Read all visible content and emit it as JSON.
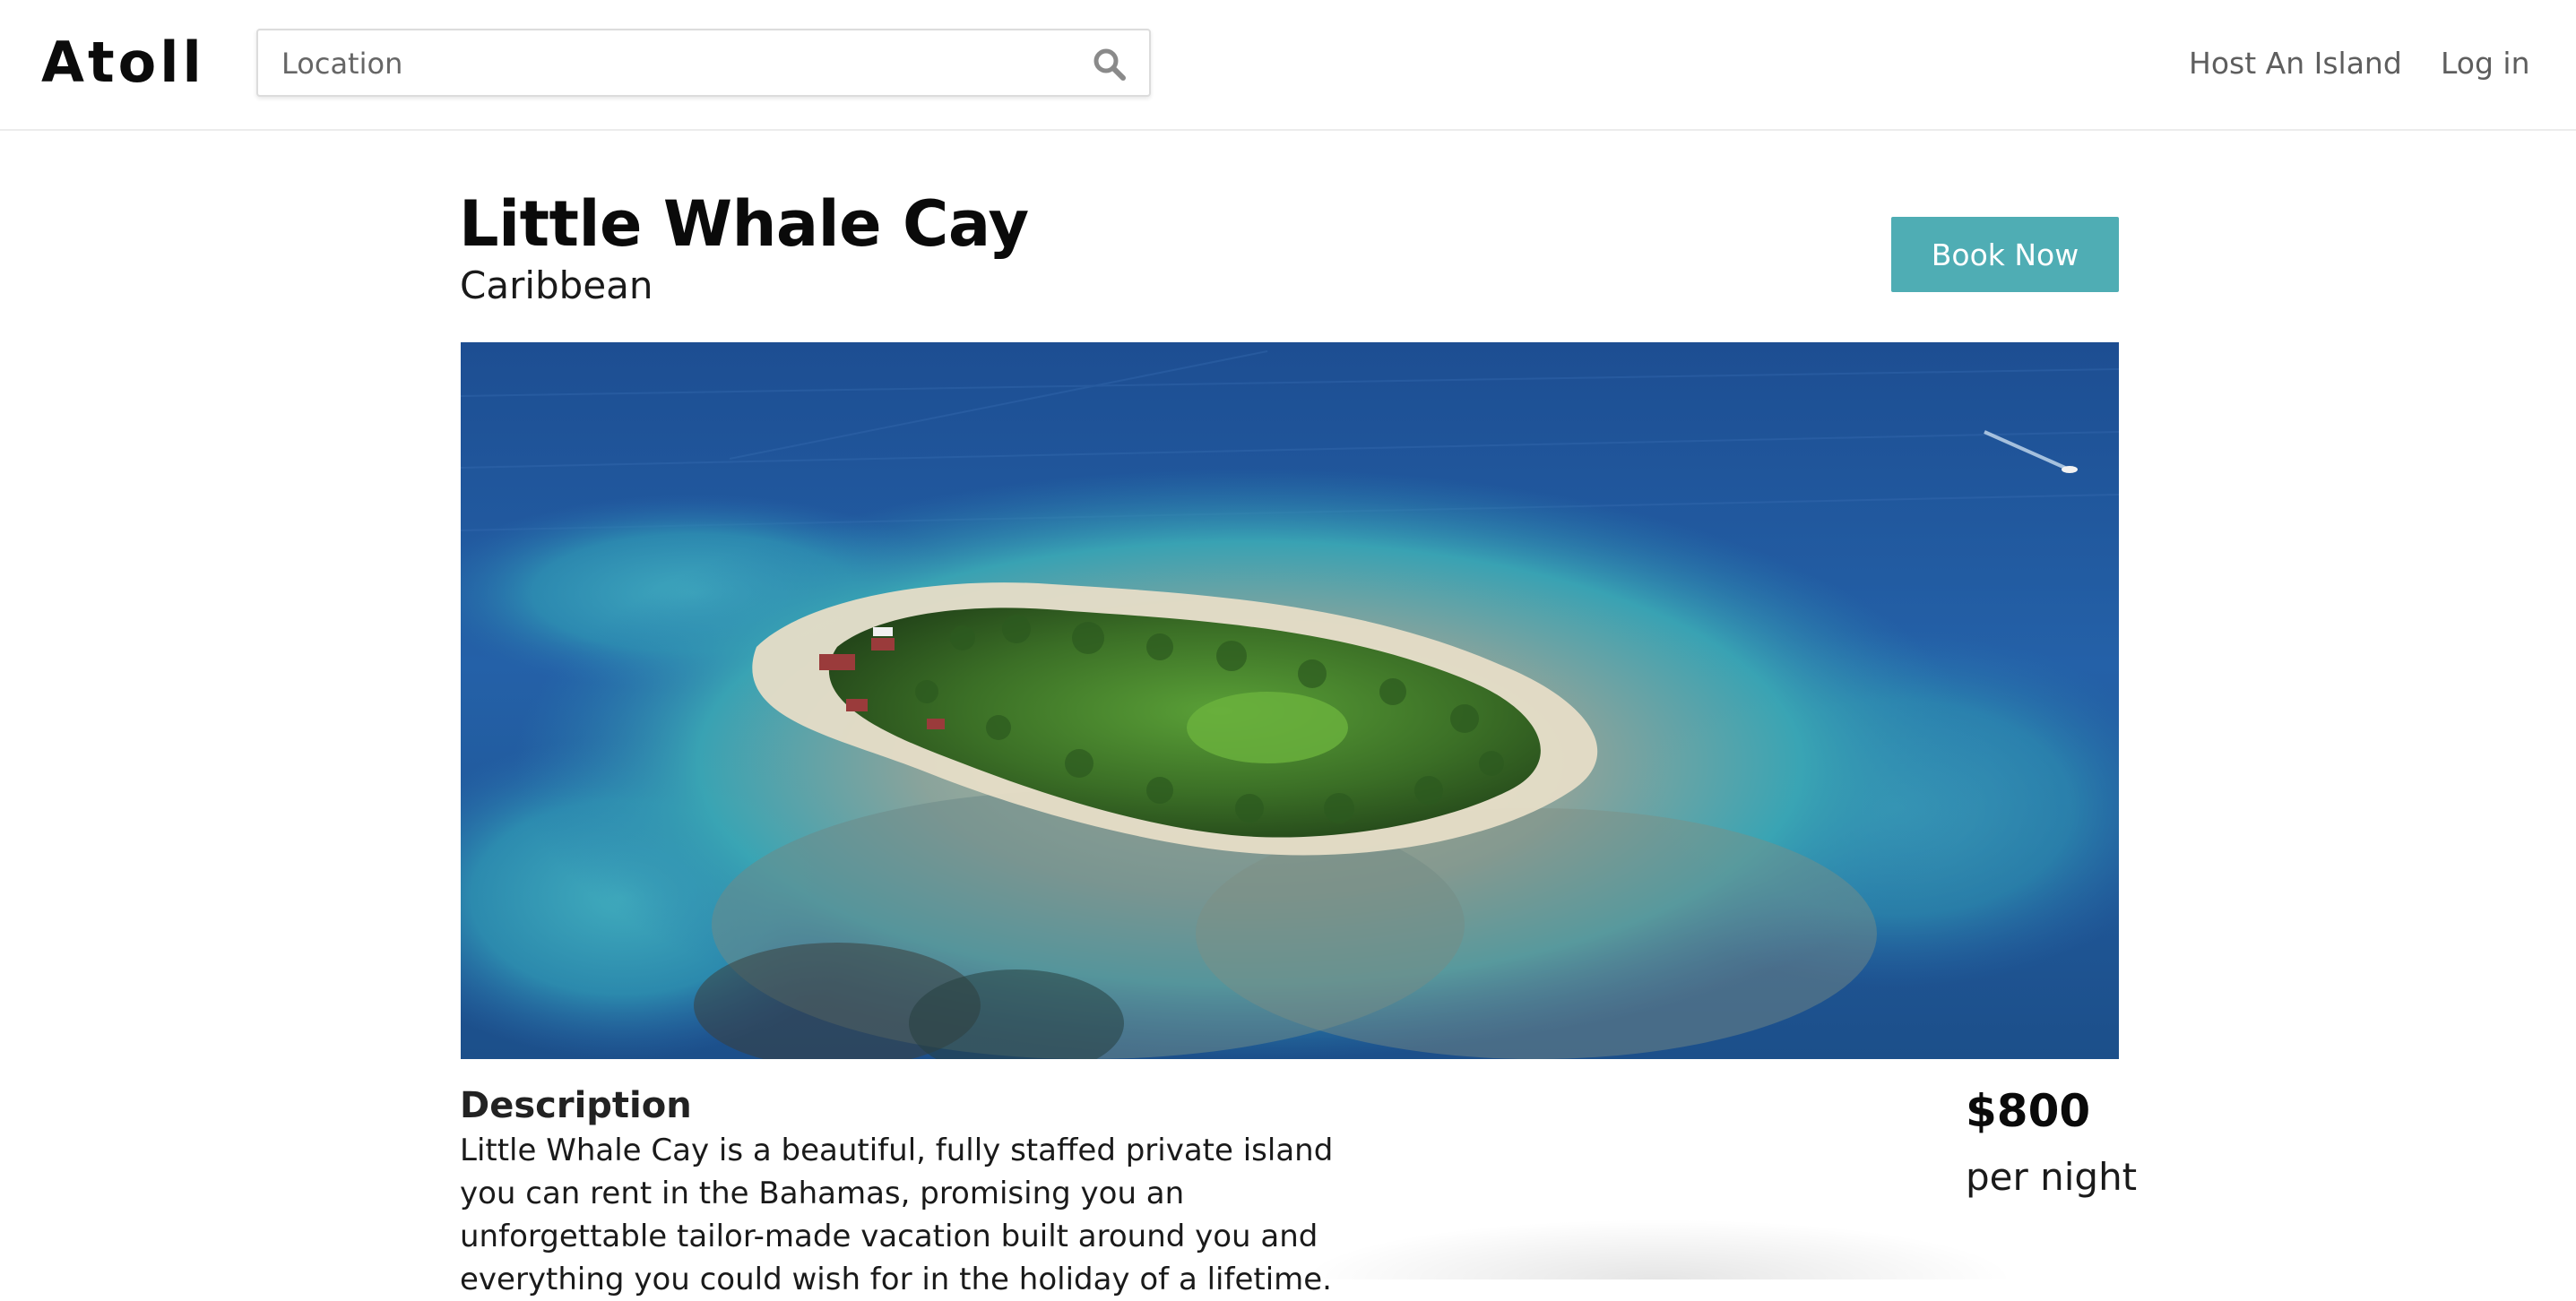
{
  "header": {
    "logo": "Atoll",
    "search": {
      "placeholder": "Location",
      "value": ""
    },
    "nav": {
      "host_label": "Host An Island",
      "login_label": "Log in"
    }
  },
  "listing": {
    "title": "Little Whale Cay",
    "region": "Caribbean",
    "book_label": "Book Now",
    "description_heading": "Description",
    "description": "Little Whale Cay is a beautiful, fully staffed private island you can rent in the Bahamas, promising you an unforgettable tailor-made vacation built around you and everything you could wish for in the holiday of a lifetime.",
    "price": "$800",
    "price_unit": "per night"
  },
  "colors": {
    "accent": "#4fadb4",
    "nav_text": "#5e5e5e",
    "ocean_deep": "#1e4a8f",
    "ocean_shallow": "#3fb6c4",
    "island_green": "#3f7a2a"
  },
  "icons": {
    "search": "search-icon",
    "hero": "island-aerial-photo"
  }
}
